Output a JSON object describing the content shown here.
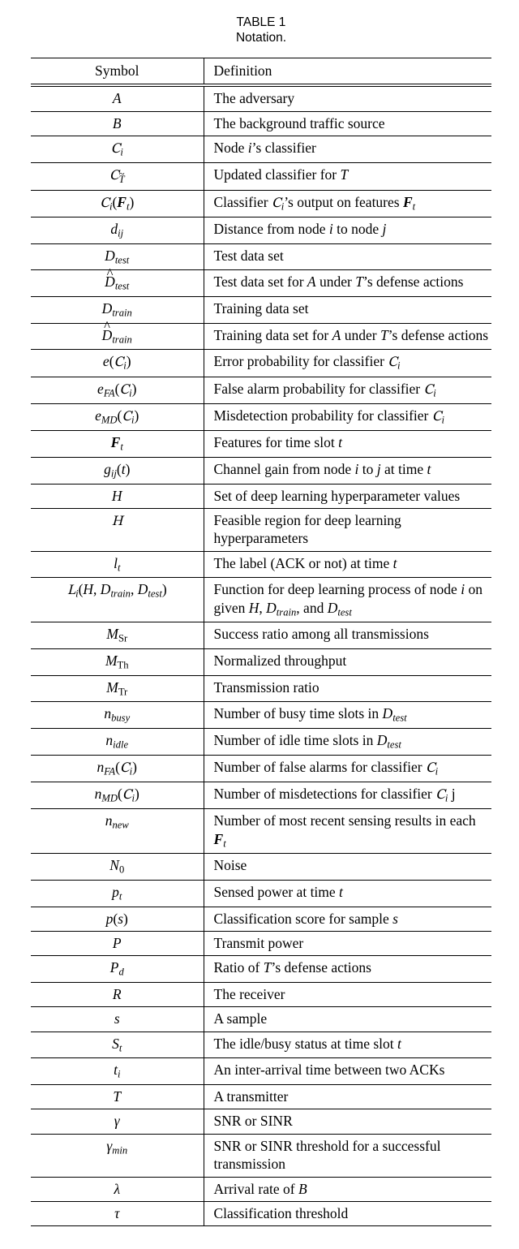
{
  "caption": {
    "label": "TABLE 1",
    "title": "Notation."
  },
  "headers": {
    "symbol": "Symbol",
    "definition": "Definition"
  },
  "chart_data": {
    "type": "table",
    "title": "TABLE 1 — Notation.",
    "columns": [
      "Symbol",
      "Definition"
    ],
    "rows": [
      [
        "A",
        "The adversary"
      ],
      [
        "B",
        "The background traffic source"
      ],
      [
        "C_i",
        "Node i's classifier"
      ],
      [
        "C_T_tilde",
        "Updated classifier for T"
      ],
      [
        "C_i(F_t)",
        "Classifier C_i's output on features F_t"
      ],
      [
        "d_ij",
        "Distance from node i to node j"
      ],
      [
        "D_test",
        "Test data set"
      ],
      [
        "D_test_hat",
        "Test data set for A under T's defense actions"
      ],
      [
        "D_train",
        "Training data set"
      ],
      [
        "D_train_hat",
        "Training data set for A under T's defense actions"
      ],
      [
        "e(C_i)",
        "Error probability for classifier C_i"
      ],
      [
        "e_FA(C_i)",
        "False alarm probability for classifier C_i"
      ],
      [
        "e_MD(C_i)",
        "Misdetection probability for classifier C_i"
      ],
      [
        "F_t",
        "Features for time slot t"
      ],
      [
        "g_ij(t)",
        "Channel gain from node i to j at time t"
      ],
      [
        "H",
        "Set of deep learning hyperparameter values"
      ],
      [
        "H_script",
        "Feasible region for deep learning hyperparameters"
      ],
      [
        "l_t",
        "The label (ACK or not) at time t"
      ],
      [
        "L_i(H, D_train, D_test)",
        "Function for deep learning process of node i on given H, D_train, and D_test"
      ],
      [
        "M_Sr",
        "Success ratio among all transmissions"
      ],
      [
        "M_Th",
        "Normalized throughput"
      ],
      [
        "M_Tr",
        "Transmission ratio"
      ],
      [
        "n_busy",
        "Number of busy time slots in D_test"
      ],
      [
        "n_idle",
        "Number of idle time slots in D_test"
      ],
      [
        "n_FA(C_i)",
        "Number of false alarms for classifier C_i"
      ],
      [
        "n_MD(C_i)",
        "Number of misdetections for classifier C_i j"
      ],
      [
        "n_new",
        "Number of most recent sensing results in each F_t"
      ],
      [
        "N_0",
        "Noise"
      ],
      [
        "p_t",
        "Sensed power at time t"
      ],
      [
        "p(s)",
        "Classification score for sample s"
      ],
      [
        "P",
        "Transmit power"
      ],
      [
        "P_d",
        "Ratio of T's defense actions"
      ],
      [
        "R",
        "The receiver"
      ],
      [
        "s",
        "A sample"
      ],
      [
        "S_t",
        "The idle/busy status at time slot t"
      ],
      [
        "t_i",
        "An inter-arrival time between two ACKs"
      ],
      [
        "T",
        "A transmitter"
      ],
      [
        "gamma",
        "SNR or SINR"
      ],
      [
        "gamma_min",
        "SNR or SINR threshold for a successful transmission"
      ],
      [
        "lambda",
        "Arrival rate of B"
      ],
      [
        "tau",
        "Classification threshold"
      ]
    ]
  },
  "rows": [
    {
      "sym_html": "<span class='it'>A</span>",
      "def_html": "The adversary"
    },
    {
      "sym_html": "<span class='it'>B</span>",
      "def_html": "The background traffic source"
    },
    {
      "sym_html": "<span class='scr'>C</span><span class='sub it'>i</span>",
      "def_html": "Node <span class='it'>i</span>&rsquo;s classifier"
    },
    {
      "sym_html": "<span class='scr'>C</span><span class='sub'><span class='tilde it'>T</span></span>",
      "def_html": "Updated classifier for <span class='it'>T</span>"
    },
    {
      "sym_html": "<span class='scr'>C</span><span class='sub it'>i</span>(<span class='bi'>F</span><span class='sub it'>t</span>)",
      "def_html": "Classifier <span class='scr'>C</span><span class='sub it'>i</span>&rsquo;s output on features <span class='bi'>F</span><span class='sub it'>t</span>"
    },
    {
      "sym_html": "<span class='it'>d</span><span class='sub it'>ij</span>",
      "def_html": "Distance from node <span class='it'>i</span> to node <span class='it'>j</span>"
    },
    {
      "sym_html": "<span class='it'>D</span><span class='sub it'>test</span>",
      "def_html": "Test data set"
    },
    {
      "sym_html": "<span class='hat it'>D</span><span class='sub it'>test</span>",
      "def_html": "Test data set for <span class='it'>A</span> under <span class='it'>T</span>&rsquo;s defense actions"
    },
    {
      "sym_html": "<span class='it'>D</span><span class='sub it'>train</span>",
      "def_html": "Training data set"
    },
    {
      "sym_html": "<span class='hat it'>D</span><span class='sub it'>train</span>",
      "def_html": "Training data set for <span class='it'>A</span> under <span class='it'>T</span>&rsquo;s defense actions"
    },
    {
      "sym_html": "<span class='it'>e</span>(<span class='scr'>C</span><span class='sub it'>i</span>)",
      "def_html": "Error probability for classifier <span class='scr'>C</span><span class='sub it'>i</span>"
    },
    {
      "sym_html": "<span class='it'>e</span><span class='sub it'>FA</span>(<span class='scr'>C</span><span class='sub it'>i</span>)",
      "def_html": "False alarm probability for classifier <span class='scr'>C</span><span class='sub it'>i</span>"
    },
    {
      "sym_html": "<span class='it'>e</span><span class='sub it'>MD</span>(<span class='scr'>C</span><span class='sub it'>i</span>)",
      "def_html": "Misdetection probability for classifier <span class='scr'>C</span><span class='sub it'>i</span>"
    },
    {
      "sym_html": "<span class='bi'>F</span><span class='sub it'>t</span>",
      "def_html": "Features for time slot <span class='it'>t</span>"
    },
    {
      "sym_html": "<span class='it'>g</span><span class='sub it'>ij</span>(<span class='it'>t</span>)",
      "def_html": "Channel gain from node <span class='it'>i</span> to <span class='it'>j</span> at time <span class='it'>t</span>"
    },
    {
      "sym_html": "<span class='it'>H</span>",
      "def_html": "Set of deep learning hyperparameter values"
    },
    {
      "sym_html": "<span class='scr'>H</span>",
      "def_html": "Feasible region for deep learning hyperparameters"
    },
    {
      "sym_html": "<span class='it'>l</span><span class='sub it'>t</span>",
      "def_html": "The label (ACK or not) at time <span class='it'>t</span>"
    },
    {
      "sym_html": "<span class='scr'>L</span><span class='sub it'>i</span>(<span class='it'>H</span>,&nbsp;<span class='it'>D</span><span class='sub it'>train</span>,&nbsp;<span class='it'>D</span><span class='sub it'>test</span>)",
      "def_html": "Function for deep learning process of node <span class='it'>i</span> on given <span class='it'>H</span>, <span class='it'>D</span><span class='sub it'>train</span>, and <span class='it'>D</span><span class='sub it'>test</span>"
    },
    {
      "sym_html": "<span class='it'>M</span><span class='sub rm'>Sr</span>",
      "def_html": "Success ratio among all transmissions"
    },
    {
      "sym_html": "<span class='it'>M</span><span class='sub rm'>Th</span>",
      "def_html": "Normalized throughput"
    },
    {
      "sym_html": "<span class='it'>M</span><span class='sub rm'>Tr</span>",
      "def_html": "Transmission ratio"
    },
    {
      "sym_html": "<span class='it'>n</span><span class='sub it'>busy</span>",
      "def_html": "Number of busy time slots in <span class='it'>D</span><span class='sub it'>test</span>"
    },
    {
      "sym_html": "<span class='it'>n</span><span class='sub it'>idle</span>",
      "def_html": "Number of idle time slots in <span class='it'>D</span><span class='sub it'>test</span>"
    },
    {
      "sym_html": "<span class='it'>n</span><span class='sub it'>FA</span>(<span class='scr'>C</span><span class='sub it'>i</span>)",
      "def_html": "Number of false alarms for classifier <span class='scr'>C</span><span class='sub it'>i</span>"
    },
    {
      "sym_html": "<span class='it'>n</span><span class='sub it'>MD</span>(<span class='scr'>C</span><span class='sub it'>i</span>)",
      "def_html": "Number of misdetections for classifier <span class='scr'>C</span><span class='sub it'>i</span> j"
    },
    {
      "sym_html": "<span class='it'>n</span><span class='sub it'>new</span>",
      "def_html": "Number of most recent sensing results in each <span class='bi'>F</span><span class='sub it'>t</span>"
    },
    {
      "sym_html": "<span class='it'>N</span><span class='sub rm'>0</span>",
      "def_html": "Noise"
    },
    {
      "sym_html": "<span class='it'>p</span><span class='sub it'>t</span>",
      "def_html": "Sensed power at time <span class='it'>t</span>"
    },
    {
      "sym_html": "<span class='it'>p</span>(<span class='it'>s</span>)",
      "def_html": "Classification score for sample <span class='it'>s</span>"
    },
    {
      "sym_html": "<span class='it'>P</span>",
      "def_html": "Transmit power"
    },
    {
      "sym_html": "<span class='it'>P</span><span class='sub it'>d</span>",
      "def_html": "Ratio of <span class='it'>T</span>&rsquo;s defense actions"
    },
    {
      "sym_html": "<span class='it'>R</span>",
      "def_html": "The receiver"
    },
    {
      "sym_html": "<span class='it'>s</span>",
      "def_html": "A sample"
    },
    {
      "sym_html": "<span class='it'>S</span><span class='sub it'>t</span>",
      "def_html": "The idle/busy status at time slot <span class='it'>t</span>"
    },
    {
      "sym_html": "<span class='it'>t</span><span class='sub it'>i</span>",
      "def_html": "An inter-arrival time between two ACKs"
    },
    {
      "sym_html": "<span class='it'>T</span>",
      "def_html": "A transmitter"
    },
    {
      "sym_html": "<span class='it'>&gamma;</span>",
      "def_html": "SNR or SINR"
    },
    {
      "sym_html": "<span class='it'>&gamma;</span><span class='sub it'>min</span>",
      "def_html": "SNR or SINR threshold for a successful transmission"
    },
    {
      "sym_html": "<span class='it'>&lambda;</span>",
      "def_html": "Arrival rate of <span class='it'>B</span>"
    },
    {
      "sym_html": "<span class='it'>&tau;</span>",
      "def_html": "Classification threshold"
    }
  ]
}
